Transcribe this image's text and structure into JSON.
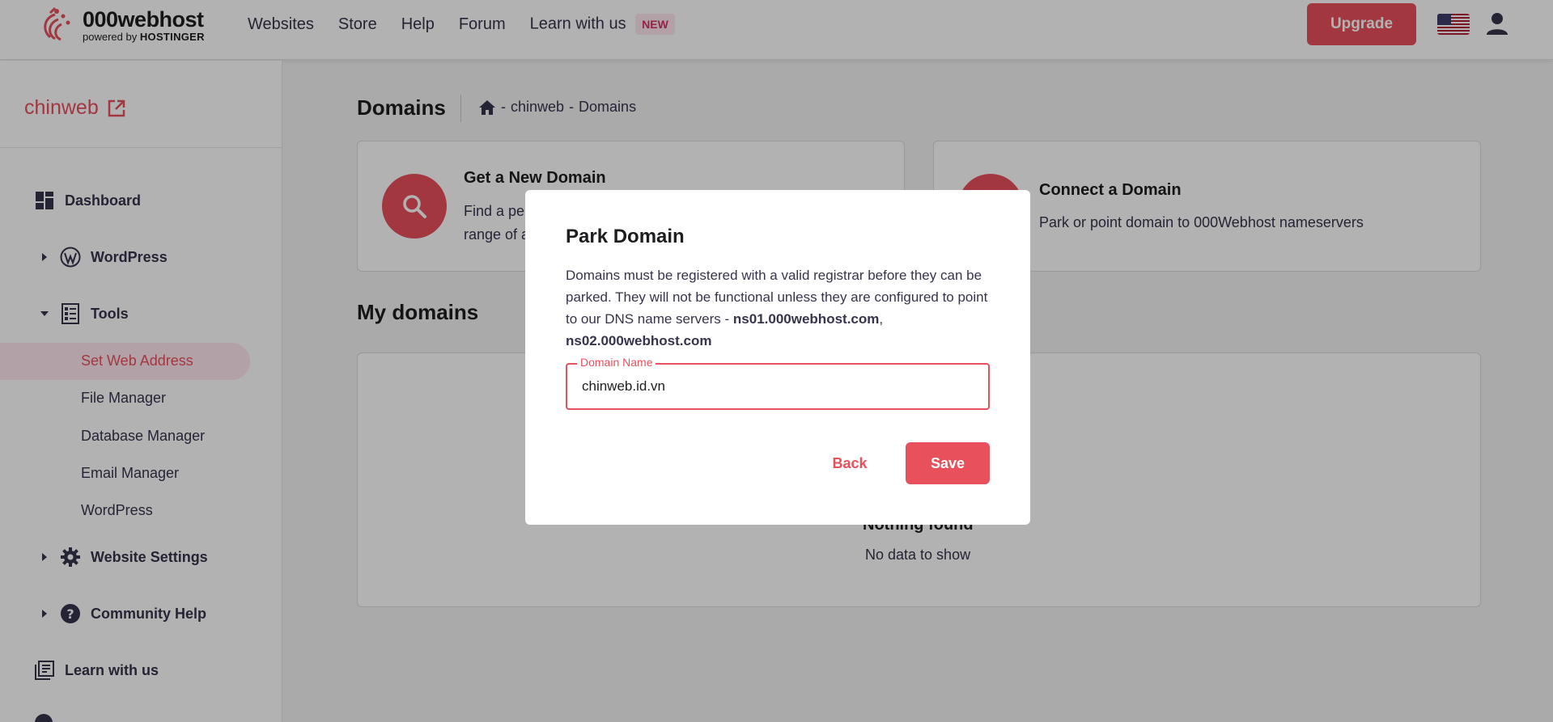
{
  "brand": {
    "name": "000webhost",
    "sub_prefix": "powered by",
    "sub_brand": "HOSTINGER",
    "accent": "#e8505b"
  },
  "nav": {
    "links": [
      "Websites",
      "Store",
      "Help",
      "Forum",
      "Learn with us"
    ],
    "new_badge": "NEW",
    "upgrade_label": "Upgrade"
  },
  "sidebar": {
    "site_name": "chinweb",
    "items": {
      "dashboard": "Dashboard",
      "wordpress": "WordPress",
      "tools": "Tools",
      "website_settings": "Website Settings",
      "community_help": "Community Help",
      "learn": "Learn with us"
    },
    "tools_sub": [
      "Set Web Address",
      "File Manager",
      "Database Manager",
      "Email Manager",
      "WordPress"
    ],
    "active_sub": "Set Web Address"
  },
  "main": {
    "page_title": "Domains",
    "breadcrumb": [
      "-",
      "chinweb",
      "-",
      "Domains"
    ],
    "card_new": {
      "title": "Get a New Domain",
      "desc_line1": "Find a pe",
      "desc_line2": "range of a"
    },
    "card_connect": {
      "title": "Connect a Domain",
      "desc": "Park or point domain to 000Webhost nameservers"
    },
    "my_domains_title": "My domains",
    "empty_title": "Nothing found",
    "empty_desc": "No data to show"
  },
  "modal": {
    "title": "Park Domain",
    "desc_text": "Domains must be registered with a valid registrar before they can be parked. They will not be functional unless they are configured to point to our DNS name servers - ",
    "ns1": "ns01.000webhost.com",
    "ns_sep": ", ",
    "ns2": "ns02.000webhost.com",
    "field_label": "Domain Name",
    "field_value": "chinweb.id.vn",
    "back_label": "Back",
    "save_label": "Save"
  }
}
